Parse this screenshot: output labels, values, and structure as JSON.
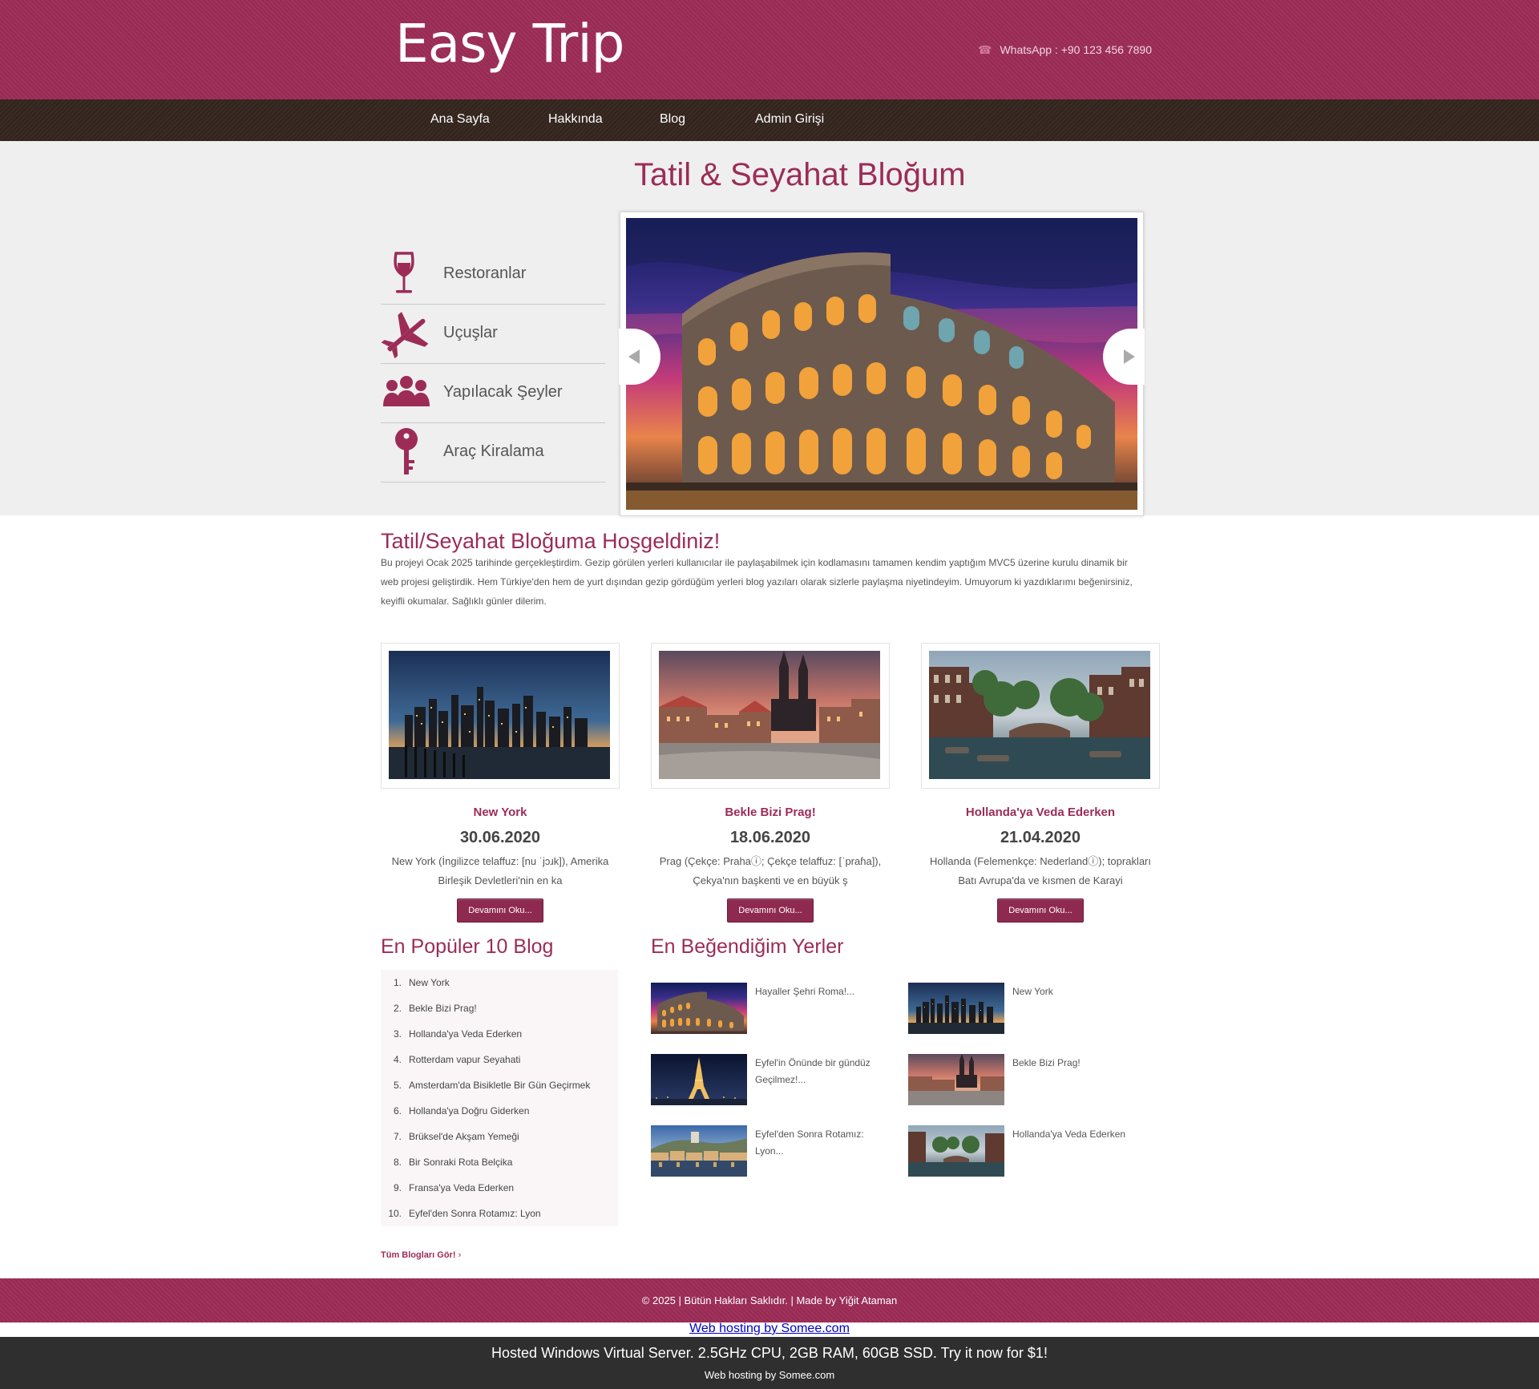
{
  "site": {
    "logo": "Easy Trip",
    "contact": "WhatsApp : +90 123 456 7890",
    "contact_icon": "phone-icon"
  },
  "nav": {
    "items": [
      "Ana Sayfa",
      "Hakkında",
      "Blog",
      "Admin Girişi"
    ]
  },
  "hero": {
    "title": "Tatil & Seyahat Bloğum",
    "categories": [
      {
        "label": "Restoranlar",
        "icon": "wine-glass-icon"
      },
      {
        "label": "Uçuşlar",
        "icon": "airplane-icon"
      },
      {
        "label": "Yapılacak Şeyler",
        "icon": "people-icon"
      },
      {
        "label": "Araç Kiralama",
        "icon": "key-icon"
      }
    ]
  },
  "welcome": {
    "title": "Tatil/Seyahat Bloğuma Hoşgeldiniz!",
    "text": "Bu projeyi Ocak 2025 tarihinde gerçekleştirdim. Gezip görülen yerleri kullanıcılar ile paylaşabilmek için kodlamasını tamamen kendim yaptığım MVC5 üzerine kurulu dinamik bir web projesi geliştirdik. Hem Türkiye'den hem de yurt dışından gezip gördüğüm yerleri blog yazıları olarak sizlerle paylaşma niyetindeyim. Umuyorum ki yazdıklarımı beğenirsiniz, keyifli okumalar. Sağlıklı günler dilerim."
  },
  "cards": [
    {
      "title": "New York",
      "date": "30.06.2020",
      "excerpt": "New York (İngilizce telaffuz: [nu ˈjɔɹk]), Amerika Birleşik Devletleri'nin en ka",
      "button": "Devamını Oku..."
    },
    {
      "title": "Bekle Bizi Prag!",
      "date": "18.06.2020",
      "excerpt": "Prag (Çekçe: Prahaⓘ; Çekçe telaffuz: [ˈpraɦa]), Çekya'nın başkenti ve en büyük ş",
      "button": "Devamını Oku..."
    },
    {
      "title": "Hollanda'ya Veda Ederken",
      "date": "21.04.2020",
      "excerpt": "Hollanda (Felemenkçe: Nederlandⓘ); toprakları Batı Avrupa'da ve kısmen de Karayi",
      "button": "Devamını Oku..."
    }
  ],
  "popular": {
    "title": "En Popüler 10 Blog",
    "items": [
      {
        "n": "1.",
        "t": "New York"
      },
      {
        "n": "2.",
        "t": "Bekle Bizi Prag!"
      },
      {
        "n": "3.",
        "t": "Hollanda'ya Veda Ederken"
      },
      {
        "n": "4.",
        "t": "Rotterdam vapur Seyahati"
      },
      {
        "n": "5.",
        "t": "Amsterdam'da Bisikletle Bir Gün Geçirmek"
      },
      {
        "n": "6.",
        "t": "Hollanda'ya Doğru Giderken"
      },
      {
        "n": "7.",
        "t": "Brüksel'de Akşam Yemeği"
      },
      {
        "n": "8.",
        "t": "Bir Sonraki Rota Belçika"
      },
      {
        "n": "9.",
        "t": "Fransa'ya Veda Ederken"
      },
      {
        "n": "10.",
        "t": "Eyfel'den Sonra Rotamız: Lyon"
      }
    ],
    "all_link": "Tüm Blogları Gör!",
    "all_link_suffix": "›"
  },
  "favorites": {
    "title": "En Beğendiğim Yerler",
    "items": [
      {
        "caption": "Hayaller Şehri Roma!..."
      },
      {
        "caption": "New York"
      },
      {
        "caption": "Eyfel'in Önünde bir gündüz Geçilmez!..."
      },
      {
        "caption": "Bekle Bizi Prag!"
      },
      {
        "caption": "Eyfel'den Sonra Rotamız: Lyon..."
      },
      {
        "caption": "Hollanda'ya Veda Ederken"
      }
    ]
  },
  "footer": {
    "text": "© 2025 | Bütün Hakları Saklıdır. | Made by Yiğit Ataman"
  },
  "hosting": {
    "link": "Web hosting by Somee.com",
    "promo": "Hosted Windows Virtual Server. 2.5GHz CPU, 2GB RAM, 60GB SSD. Try it now for $1!",
    "small": "Web hosting by Somee.com"
  },
  "colors": {
    "brand": "#9c2c56",
    "nav": "#35261f",
    "hero_bg": "#efefef",
    "host_bar": "#2f2f2f"
  }
}
